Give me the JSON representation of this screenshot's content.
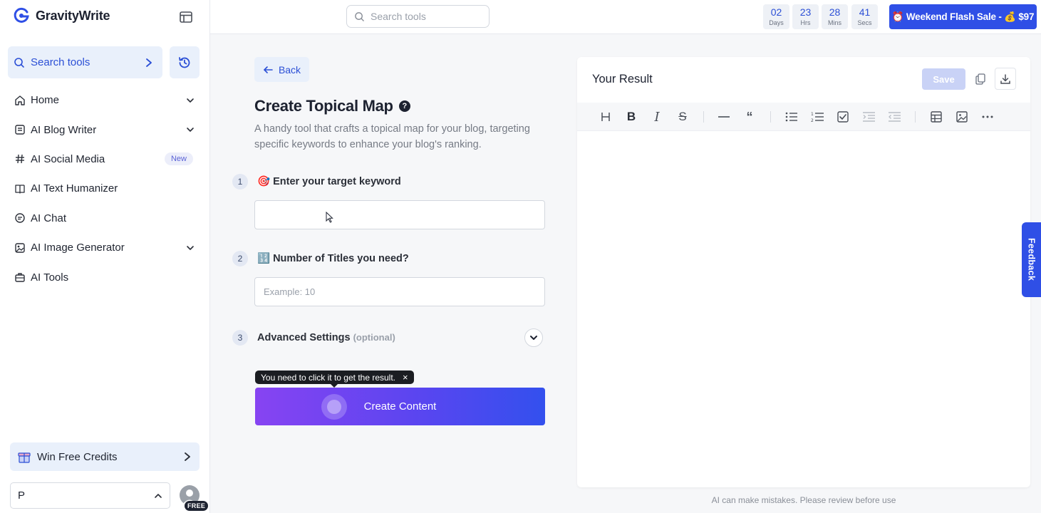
{
  "app": {
    "name": "GravityWrite"
  },
  "sidebar": {
    "search_label": "Search tools",
    "items": [
      {
        "label": "Home",
        "icon": "home-icon",
        "chevron": true
      },
      {
        "label": "AI Blog Writer",
        "icon": "document-icon",
        "chevron": true
      },
      {
        "label": "AI Social Media",
        "icon": "hash-icon",
        "badge": "New"
      },
      {
        "label": "AI Text Humanizer",
        "icon": "book-icon"
      },
      {
        "label": "AI Chat",
        "icon": "chat-icon"
      },
      {
        "label": "AI Image Generator",
        "icon": "image-icon",
        "chevron": true
      },
      {
        "label": "AI Tools",
        "icon": "briefcase-icon"
      }
    ],
    "win_credits": "Win Free Credits",
    "workspace": "P",
    "plan_badge": "FREE"
  },
  "topbar": {
    "search_placeholder": "Search tools",
    "countdown": [
      {
        "value": "02",
        "unit": "Days"
      },
      {
        "value": "23",
        "unit": "Hrs"
      },
      {
        "value": "28",
        "unit": "Mins"
      },
      {
        "value": "41",
        "unit": "Secs"
      }
    ],
    "flash_sale": "⏰ Weekend Flash Sale - 💰 $97"
  },
  "form": {
    "back_label": "Back",
    "title": "Create Topical Map",
    "description": "A handy tool that crafts a topical map for your blog, targeting specific keywords to enhance your blog's ranking.",
    "steps": [
      {
        "num": "1",
        "label": "🎯 Enter your target keyword",
        "value": "",
        "placeholder": ""
      },
      {
        "num": "2",
        "label": "🔢 Number of Titles you need?",
        "value": "",
        "placeholder": "Example: 10"
      },
      {
        "num": "3",
        "label": "Advanced Settings",
        "optional": "(optional)"
      }
    ],
    "tooltip": "You need to click it to get the result.",
    "tooltip_close": "×",
    "create_label": "Create Content"
  },
  "result": {
    "title": "Your Result",
    "save_label": "Save",
    "toolbar": [
      "heading-icon",
      "bold-icon",
      "italic-icon",
      "strikethrough-icon",
      "horizontal-rule-icon",
      "quote-icon",
      "bullet-list-icon",
      "ordered-list-icon",
      "task-list-icon",
      "indent-icon",
      "outdent-icon",
      "table-icon",
      "image-icon",
      "more-icon"
    ],
    "disclaimer": "AI can make mistakes. Please review before use"
  },
  "feedback_label": "Feedback",
  "colors": {
    "accent": "#2f4fe6",
    "gradient_start": "#8744f2",
    "gradient_end": "#3350ee"
  }
}
